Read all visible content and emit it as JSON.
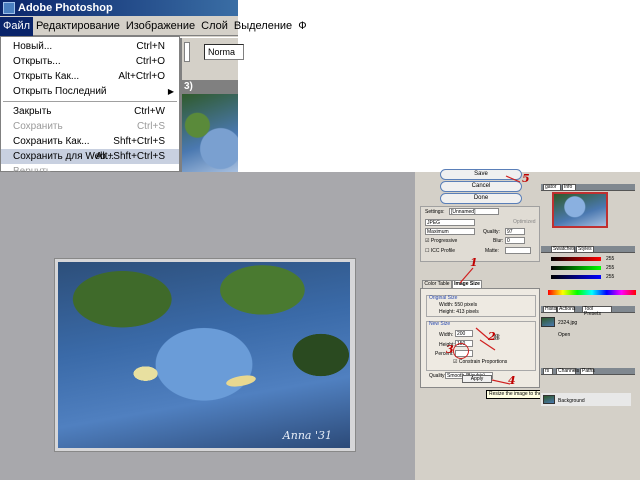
{
  "window": {
    "title": "Adobe Photoshop",
    "menubar": [
      "Файл",
      "Редактирование",
      "Изображение",
      "Слой",
      "Выделение",
      "Ф"
    ],
    "toolbar_select": "Norma",
    "doc_title_fragment": "3)"
  },
  "file_menu": {
    "items": [
      {
        "label": "Новый...",
        "shortcut": "Ctrl+N",
        "disabled": false
      },
      {
        "label": "Открыть...",
        "shortcut": "Ctrl+O",
        "disabled": false
      },
      {
        "label": "Открыть Как...",
        "shortcut": "Alt+Ctrl+O",
        "disabled": false
      },
      {
        "label": "Открыть Последний",
        "shortcut": "",
        "disabled": false,
        "submenu": true
      },
      {
        "label": "Закрыть",
        "shortcut": "Ctrl+W",
        "disabled": false
      },
      {
        "label": "Сохранить",
        "shortcut": "Ctrl+S",
        "disabled": true
      },
      {
        "label": "Сохранить Как...",
        "shortcut": "Shft+Ctrl+S",
        "disabled": false
      },
      {
        "label": "Сохранить для Web...",
        "shortcut": "Alt+Shft+Ctrl+S",
        "disabled": false,
        "highlighted": true
      },
      {
        "label": "Вернуть",
        "shortcut": "",
        "disabled": true
      }
    ]
  },
  "save_for_web": {
    "buttons": {
      "save": "Save",
      "cancel": "Cancel",
      "done": "Done"
    },
    "settings_label": "Settings:",
    "settings_value": "[Unnamed]",
    "format": "JPEG",
    "optimized_label": "Optimized",
    "quality_preset": "Maximum",
    "quality_label": "Quality:",
    "quality_value": "97",
    "progressive_label": "Progressive",
    "blur_label": "Blur:",
    "blur_value": "0",
    "icc_label": "ICC Profile",
    "matte_label": "Matte:",
    "tabs": [
      "Color Table",
      "Image Size"
    ],
    "original_size_caption": "Original Size",
    "original_width": "Width: 550 pixels",
    "original_height": "Height: 413 pixels",
    "new_size_caption": "New Size",
    "width_label": "Width:",
    "width_value": "200",
    "height_label": "Height:",
    "height_value": "150",
    "percent_label": "Percent:",
    "constrain_label": "Constrain Proportions",
    "quality_resample_label": "Quality:",
    "quality_resample_value": "Smooth (Bicubic)",
    "apply_label": "Apply",
    "tooltip": "Resize the image to the new settings"
  },
  "panels": {
    "navigator_tabs": [
      "gator",
      "Info"
    ],
    "swatches_tabs": [
      "Swatches",
      "Styles"
    ],
    "history_tabs": [
      "History",
      "Actions",
      "Tool Presets"
    ],
    "history_file": "2324.jpg",
    "history_step": "Open",
    "layers_tabs": [
      "rs",
      "Channels",
      "Paths"
    ],
    "layer_name": "Background",
    "color_values": [
      "255",
      "255",
      "255"
    ]
  },
  "photo_signature": "Anna '31",
  "annotations": [
    "1",
    "2",
    "3",
    "4",
    "5"
  ]
}
